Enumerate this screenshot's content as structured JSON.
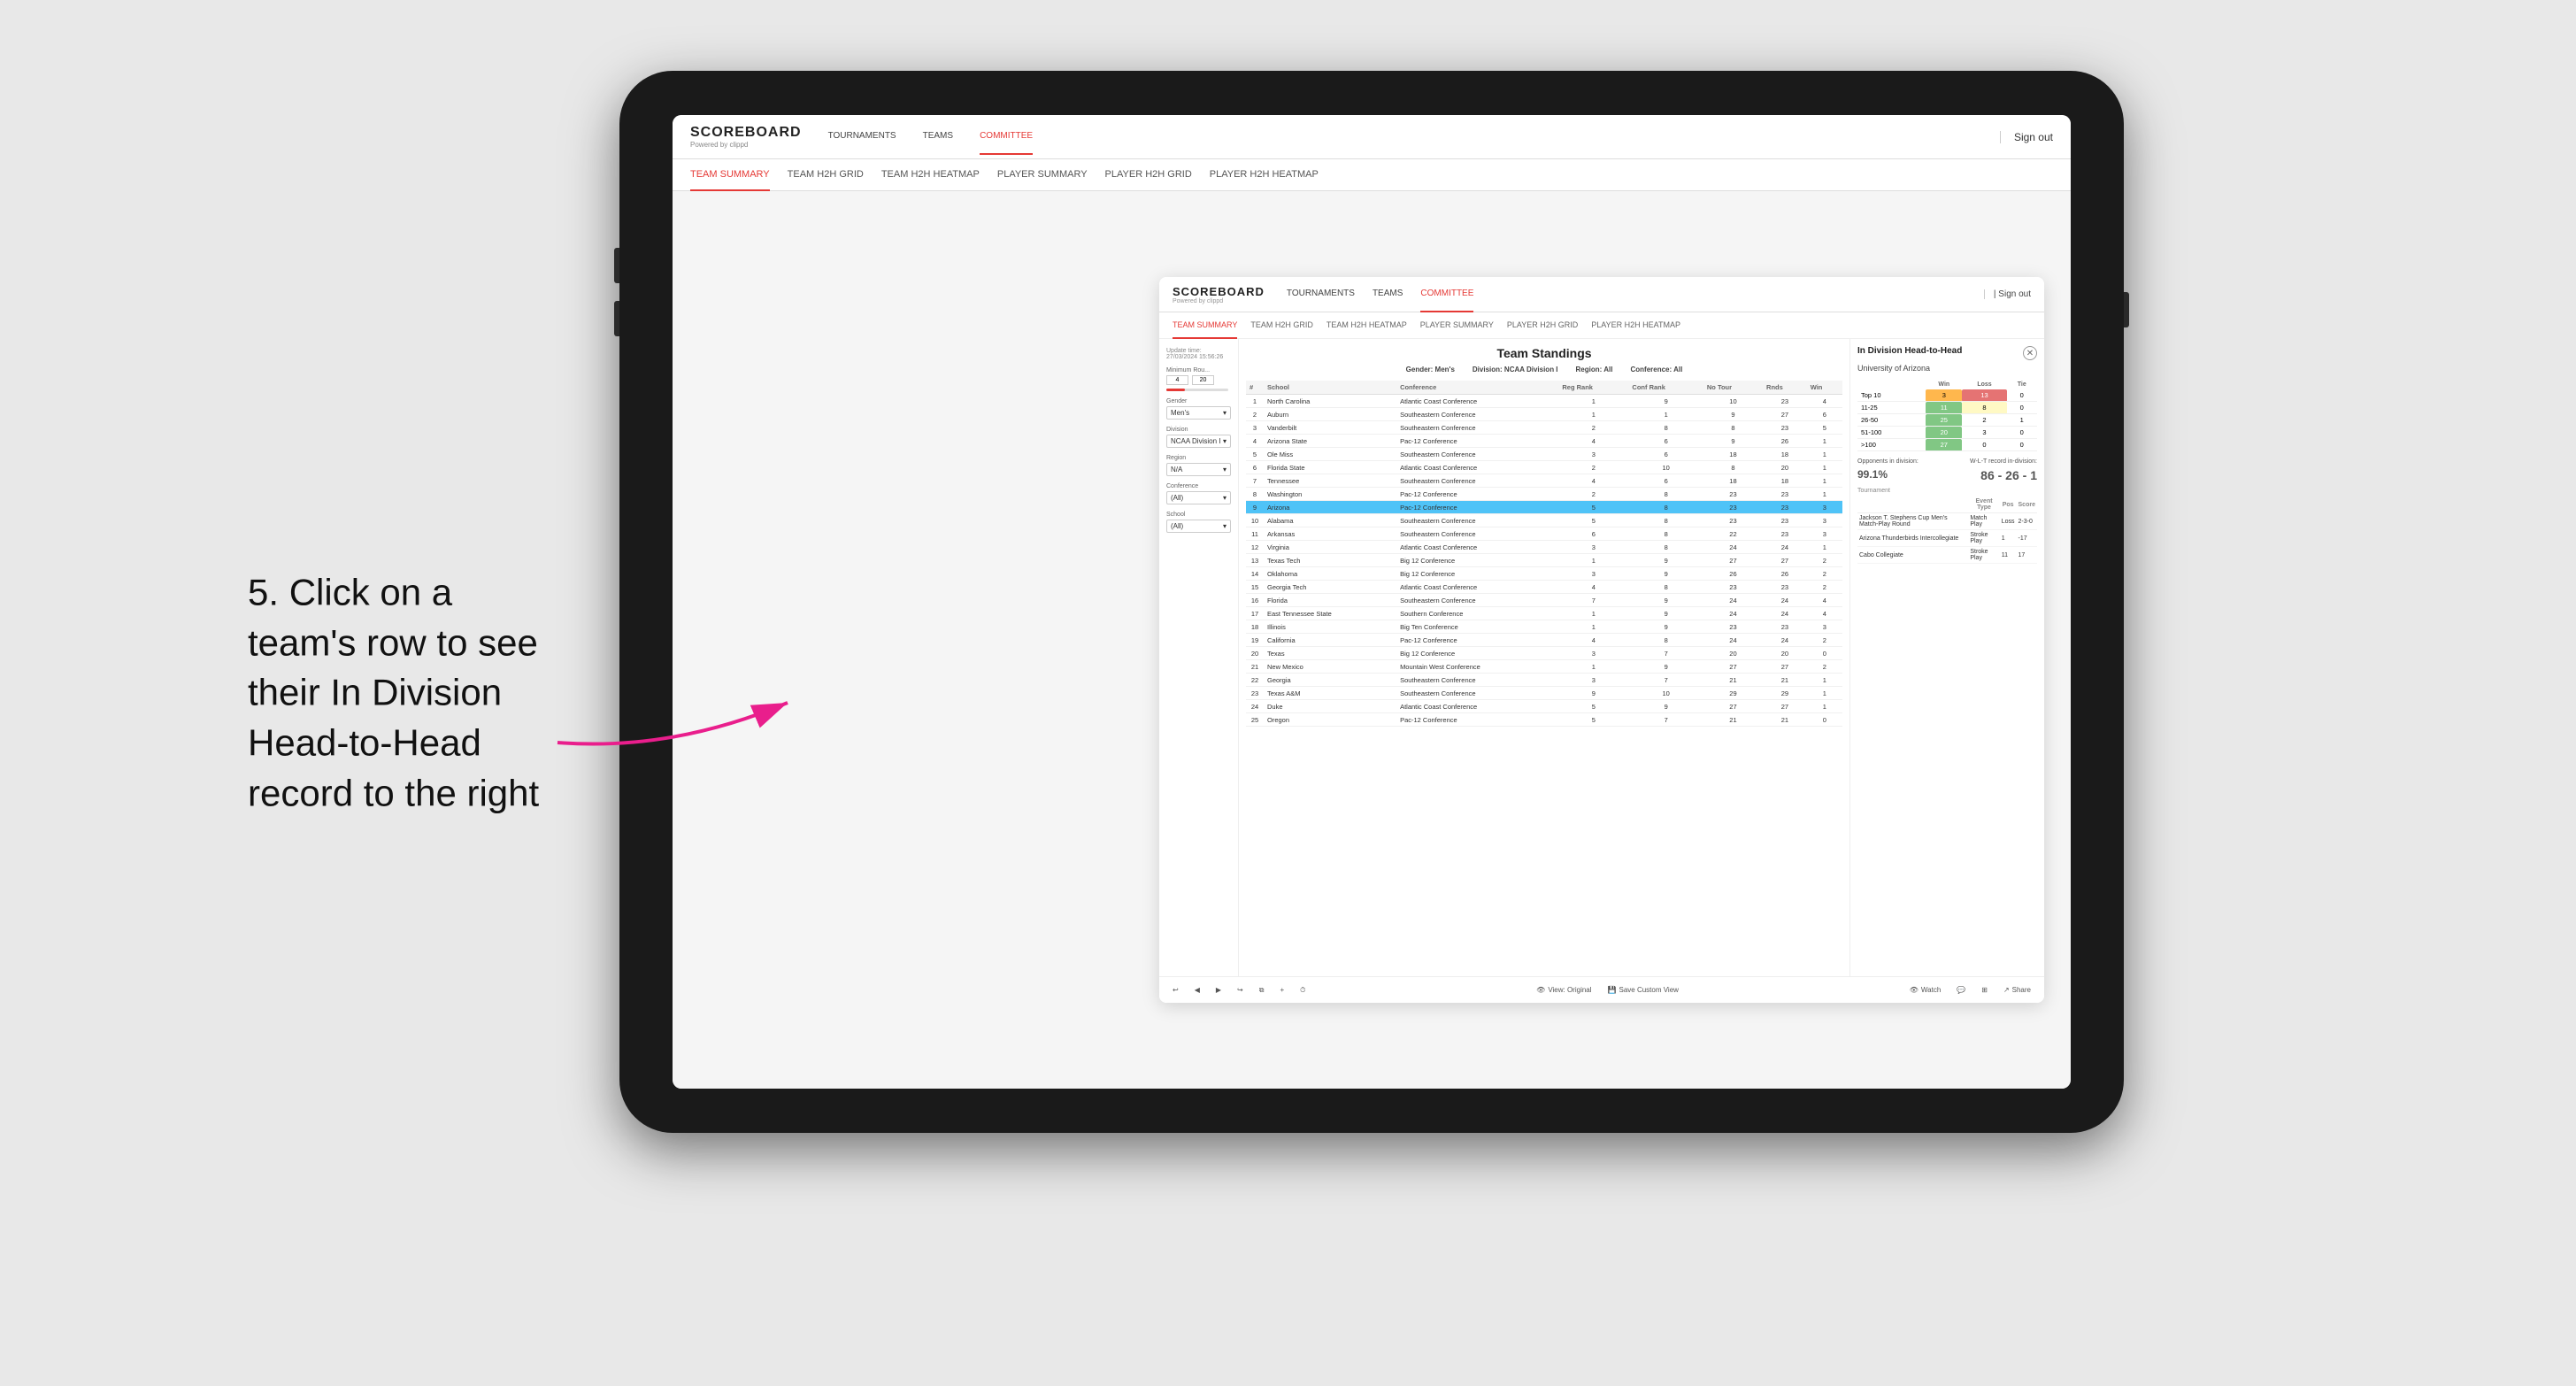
{
  "page": {
    "background": "#e8e8e8"
  },
  "annotation": {
    "step": "5.",
    "line1": "Click on a",
    "line2": "team's row to see",
    "line3": "their In Division",
    "line4": "Head-to-Head",
    "line5": "record to the right"
  },
  "top_nav": {
    "logo": "SCOREBOARD",
    "logo_sub": "Powered by clippd",
    "items": [
      "TOURNAMENTS",
      "TEAMS",
      "COMMITTEE"
    ],
    "sign_out": "Sign out"
  },
  "sub_nav": {
    "items": [
      "TEAM SUMMARY",
      "TEAM H2H GRID",
      "TEAM H2H HEATMAP",
      "PLAYER SUMMARY",
      "PLAYER H2H GRID",
      "PLAYER H2H HEATMAP"
    ],
    "active": "PLAYER SUMMARY"
  },
  "scoreboard": {
    "update_time_label": "Update time:",
    "update_time": "27/03/2024 15:56:26",
    "title": "Team Standings",
    "gender_label": "Gender:",
    "gender": "Men's",
    "division_label": "Division:",
    "division": "NCAA Division I",
    "region_label": "Region:",
    "region": "All",
    "conference_label": "Conference:",
    "conference": "All",
    "filters": {
      "min_rounds_label": "Minimum Rou...",
      "min_val": "4",
      "max_val": "20",
      "gender_label": "Gender",
      "gender_val": "Men's",
      "division_label": "Division",
      "division_val": "NCAA Division I",
      "region_label": "Region",
      "region_val": "N/A",
      "conference_label": "Conference",
      "conference_val": "(All)",
      "school_label": "School",
      "school_val": "(All)"
    },
    "table_headers": [
      "#",
      "School",
      "Conference",
      "Reg Rank",
      "Conf Rank",
      "No Tour",
      "Rnds",
      "Win"
    ],
    "teams": [
      {
        "rank": 1,
        "school": "North Carolina",
        "conference": "Atlantic Coast Conference",
        "reg_rank": 1,
        "conf_rank": 9,
        "no_tour": 10,
        "rnds": 23,
        "win": 4
      },
      {
        "rank": 2,
        "school": "Auburn",
        "conference": "Southeastern Conference",
        "reg_rank": 1,
        "conf_rank": 1,
        "no_tour": 9,
        "rnds": 27,
        "win": 6
      },
      {
        "rank": 3,
        "school": "Vanderbilt",
        "conference": "Southeastern Conference",
        "reg_rank": 2,
        "conf_rank": 8,
        "no_tour": 8,
        "rnds": 23,
        "win": 5
      },
      {
        "rank": 4,
        "school": "Arizona State",
        "conference": "Pac-12 Conference",
        "reg_rank": 4,
        "conf_rank": 6,
        "no_tour": 9,
        "rnds": 26,
        "win": 1
      },
      {
        "rank": 5,
        "school": "Ole Miss",
        "conference": "Southeastern Conference",
        "reg_rank": 3,
        "conf_rank": 6,
        "no_tour": 18,
        "rnds": 18,
        "win": 1
      },
      {
        "rank": 6,
        "school": "Florida State",
        "conference": "Atlantic Coast Conference",
        "reg_rank": 2,
        "conf_rank": 10,
        "no_tour": 8,
        "rnds": 20,
        "win": 1
      },
      {
        "rank": 7,
        "school": "Tennessee",
        "conference": "Southeastern Conference",
        "reg_rank": 4,
        "conf_rank": 6,
        "no_tour": 18,
        "rnds": 18,
        "win": 1
      },
      {
        "rank": 8,
        "school": "Washington",
        "conference": "Pac-12 Conference",
        "reg_rank": 2,
        "conf_rank": 8,
        "no_tour": 23,
        "rnds": 23,
        "win": 1
      },
      {
        "rank": 9,
        "school": "Arizona",
        "conference": "Pac-12 Conference",
        "reg_rank": 5,
        "conf_rank": 8,
        "no_tour": 23,
        "rnds": 23,
        "win": 3,
        "highlighted": true
      },
      {
        "rank": 10,
        "school": "Alabama",
        "conference": "Southeastern Conference",
        "reg_rank": 5,
        "conf_rank": 8,
        "no_tour": 23,
        "rnds": 23,
        "win": 3
      },
      {
        "rank": 11,
        "school": "Arkansas",
        "conference": "Southeastern Conference",
        "reg_rank": 6,
        "conf_rank": 8,
        "no_tour": 22,
        "rnds": 23,
        "win": 3
      },
      {
        "rank": 12,
        "school": "Virginia",
        "conference": "Atlantic Coast Conference",
        "reg_rank": 3,
        "conf_rank": 8,
        "no_tour": 24,
        "rnds": 24,
        "win": 1
      },
      {
        "rank": 13,
        "school": "Texas Tech",
        "conference": "Big 12 Conference",
        "reg_rank": 1,
        "conf_rank": 9,
        "no_tour": 27,
        "rnds": 27,
        "win": 2
      },
      {
        "rank": 14,
        "school": "Oklahoma",
        "conference": "Big 12 Conference",
        "reg_rank": 3,
        "conf_rank": 9,
        "no_tour": 26,
        "rnds": 26,
        "win": 2
      },
      {
        "rank": 15,
        "school": "Georgia Tech",
        "conference": "Atlantic Coast Conference",
        "reg_rank": 4,
        "conf_rank": 8,
        "no_tour": 23,
        "rnds": 23,
        "win": 2
      },
      {
        "rank": 16,
        "school": "Florida",
        "conference": "Southeastern Conference",
        "reg_rank": 7,
        "conf_rank": 9,
        "no_tour": 24,
        "rnds": 24,
        "win": 4
      },
      {
        "rank": 17,
        "school": "East Tennessee State",
        "conference": "Southern Conference",
        "reg_rank": 1,
        "conf_rank": 9,
        "no_tour": 24,
        "rnds": 24,
        "win": 4
      },
      {
        "rank": 18,
        "school": "Illinois",
        "conference": "Big Ten Conference",
        "reg_rank": 1,
        "conf_rank": 9,
        "no_tour": 23,
        "rnds": 23,
        "win": 3
      },
      {
        "rank": 19,
        "school": "California",
        "conference": "Pac-12 Conference",
        "reg_rank": 4,
        "conf_rank": 8,
        "no_tour": 24,
        "rnds": 24,
        "win": 2
      },
      {
        "rank": 20,
        "school": "Texas",
        "conference": "Big 12 Conference",
        "reg_rank": 3,
        "conf_rank": 7,
        "no_tour": 20,
        "rnds": 20,
        "win": 0
      },
      {
        "rank": 21,
        "school": "New Mexico",
        "conference": "Mountain West Conference",
        "reg_rank": 1,
        "conf_rank": 9,
        "no_tour": 27,
        "rnds": 27,
        "win": 2
      },
      {
        "rank": 22,
        "school": "Georgia",
        "conference": "Southeastern Conference",
        "reg_rank": 3,
        "conf_rank": 7,
        "no_tour": 21,
        "rnds": 21,
        "win": 1
      },
      {
        "rank": 23,
        "school": "Texas A&M",
        "conference": "Southeastern Conference",
        "reg_rank": 9,
        "conf_rank": 10,
        "no_tour": 29,
        "rnds": 29,
        "win": 1
      },
      {
        "rank": 24,
        "school": "Duke",
        "conference": "Atlantic Coast Conference",
        "reg_rank": 5,
        "conf_rank": 9,
        "no_tour": 27,
        "rnds": 27,
        "win": 1
      },
      {
        "rank": 25,
        "school": "Oregon",
        "conference": "Pac-12 Conference",
        "reg_rank": 5,
        "conf_rank": 7,
        "no_tour": 21,
        "rnds": 21,
        "win": 0
      }
    ],
    "h2h": {
      "title": "In Division Head-to-Head",
      "school": "University of Arizona",
      "headers": [
        "Win",
        "Loss",
        "Tie"
      ],
      "rows": [
        {
          "range": "Top 10",
          "win": 3,
          "loss": 13,
          "tie": 0,
          "win_color": "orange",
          "loss_color": "red"
        },
        {
          "range": "11-25",
          "win": 11,
          "loss": 8,
          "tie": 0,
          "win_color": "green",
          "loss_color": "yellow"
        },
        {
          "range": "26-50",
          "win": 25,
          "loss": 2,
          "tie": 1,
          "win_color": "green",
          "loss_color": "white"
        },
        {
          "range": "51-100",
          "win": 20,
          "loss": 3,
          "tie": 0,
          "win_color": "green",
          "loss_color": "white"
        },
        {
          "range": ">100",
          "win": 27,
          "loss": 0,
          "tie": 0,
          "win_color": "green",
          "loss_color": "white"
        }
      ],
      "opponents_label": "Opponents in division:",
      "opponents_val": "99.1%",
      "wlt_label": "W-L-T record in-division:",
      "wlt_val": "86 - 26 - 1",
      "tournaments": [
        {
          "name": "Jackson T. Stephens Cup Men's Match-Play Round",
          "event_type": "Match Play",
          "pos": "Loss",
          "score": "2-3-0"
        },
        {
          "name": "Arizona Thunderbirds Intercollegiate",
          "event_type": "Stroke Play",
          "pos": "1",
          "score": "-17"
        },
        {
          "name": "Cabo Collegiate",
          "event_type": "Stroke Play",
          "pos": "11",
          "score": "17"
        }
      ]
    },
    "toolbar": {
      "undo": "↩",
      "redo": "↪",
      "view_original": "View: Original",
      "save_custom": "Save Custom View",
      "watch": "Watch",
      "share": "Share"
    }
  }
}
